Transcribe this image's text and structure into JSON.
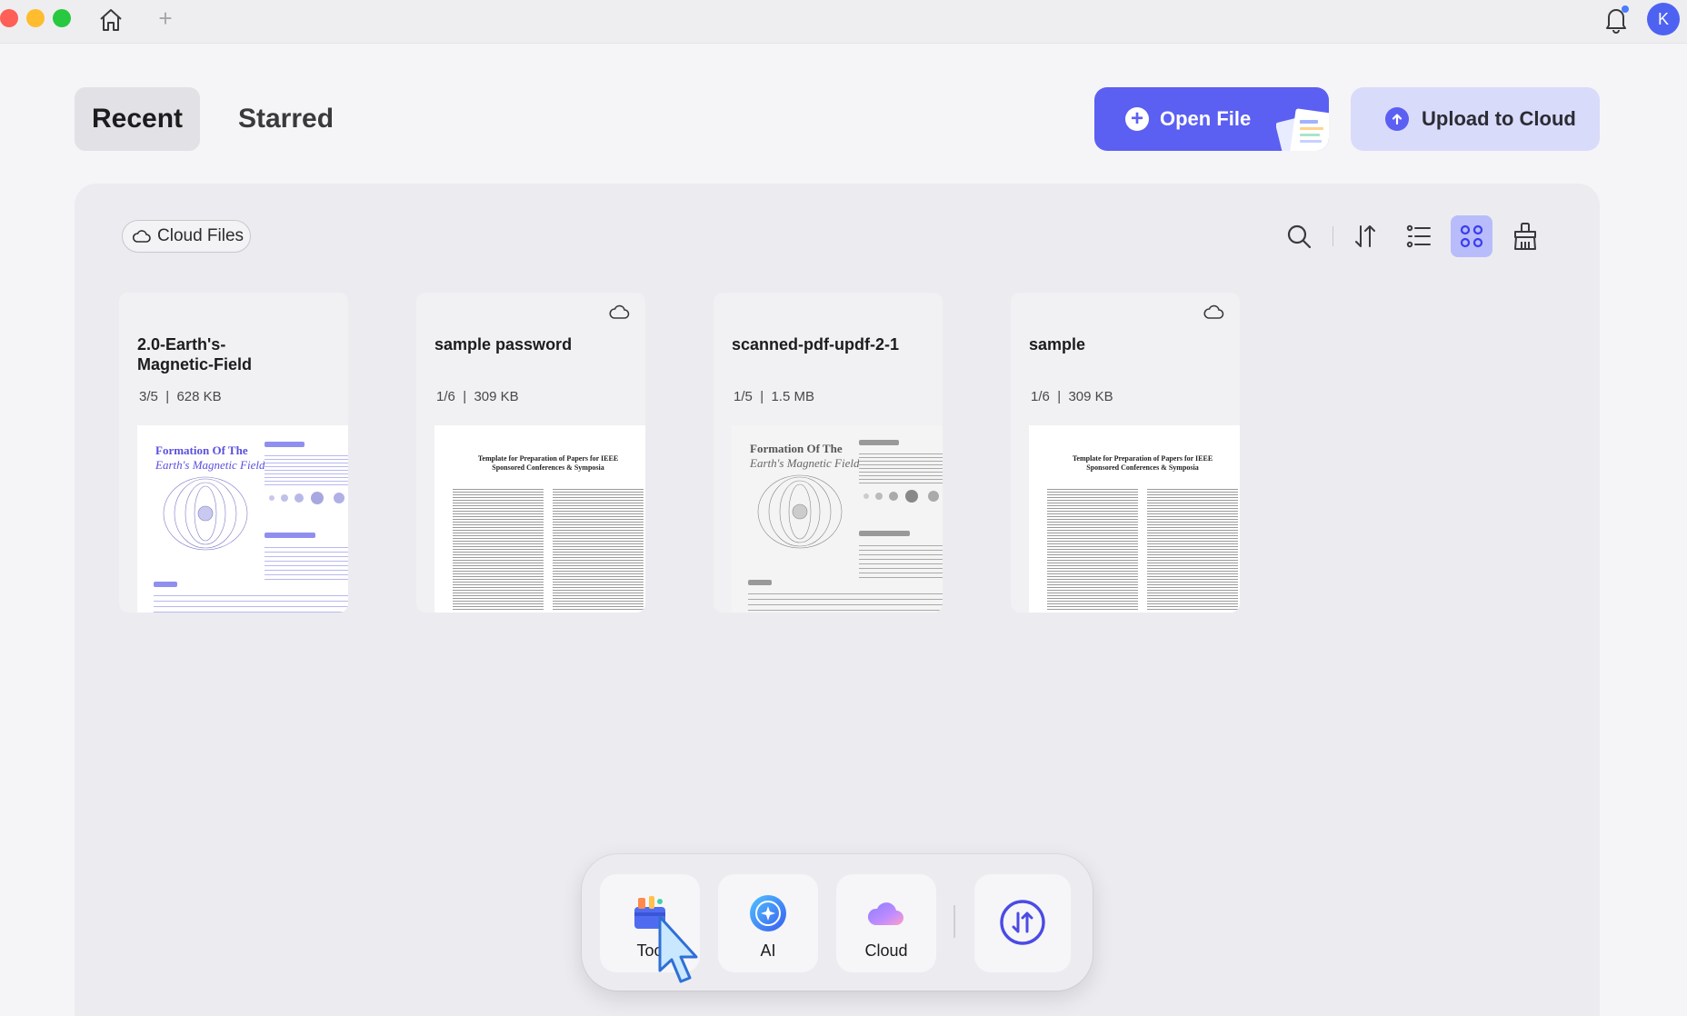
{
  "titlebar": {
    "avatar_initial": "K"
  },
  "tabs": {
    "recent": "Recent",
    "starred": "Starred"
  },
  "actions": {
    "open_file": "Open File",
    "upload": "Upload to Cloud"
  },
  "toolbar": {
    "cloud_files": "Cloud Files"
  },
  "files": [
    {
      "title": "2.0-Earth's-\nMagnetic-Field",
      "pages": "3/5",
      "size": "628 KB"
    },
    {
      "title": "sample password",
      "pages": "1/6",
      "size": "309 KB"
    },
    {
      "title": "scanned-pdf-updf-2-1",
      "pages": "1/5",
      "size": "1.5 MB"
    },
    {
      "title": "sample",
      "pages": "1/6",
      "size": "309 KB"
    }
  ],
  "thumbs": {
    "earth_title_1": "Formation Of The",
    "earth_title_2": "Earth's Magnetic Field",
    "ieee_title": "Template for Preparation of Papers for IEEE Sponsored Conferences & Symposia"
  },
  "dock": {
    "tools": "Too",
    "ai": "AI",
    "cloud": "Cloud"
  },
  "colors": {
    "accent": "#5b5ff2",
    "accent_light": "#d9dbfb",
    "grid_active": "#b8bcfa"
  }
}
